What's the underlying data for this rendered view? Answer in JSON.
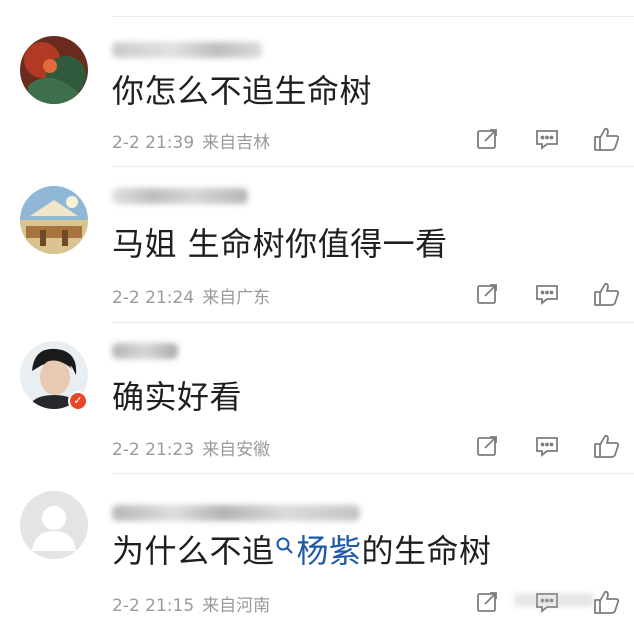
{
  "comments": [
    {
      "text": "你怎么不追生命树",
      "time": "2-2 21:39",
      "location": "来自吉林"
    },
    {
      "text": "马姐 生命树你值得一看",
      "time": "2-2 21:24",
      "location": "来自广东"
    },
    {
      "text": "确实好看",
      "time": "2-2 21:23",
      "location": "来自安徽"
    },
    {
      "text_before": "为什么不追",
      "topic": "杨紫",
      "text_after": "的生命树",
      "time": "2-2 21:15",
      "location": "来自河南"
    }
  ],
  "icons": {
    "edit": "edit-icon",
    "reply": "comment-icon",
    "like": "thumbs-up-icon",
    "topic": "search-icon"
  },
  "colors": {
    "text": "#1f1f1f",
    "meta": "#9a9a9a",
    "topic": "#1e5aa8",
    "icon": "#7d7d7d",
    "divider": "#ececec"
  }
}
